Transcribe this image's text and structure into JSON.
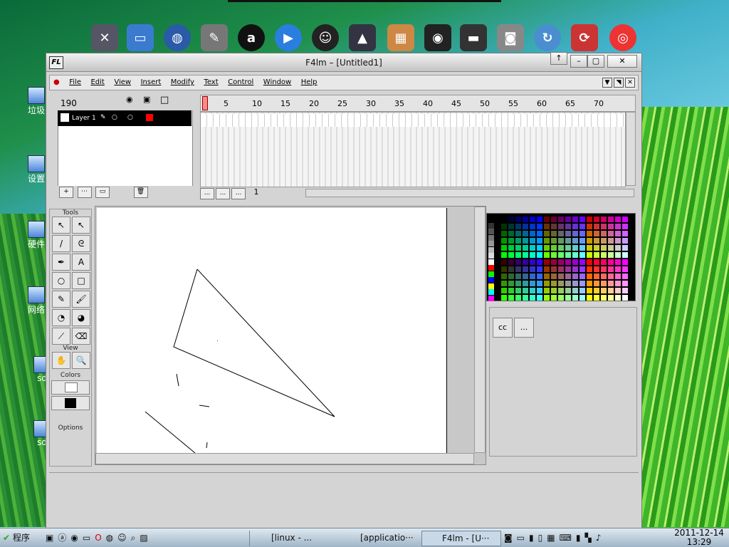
{
  "window": {
    "title": "F4lm  – [Untitled1]",
    "logo": "FL"
  },
  "menu": [
    "File",
    "Edit",
    "View",
    "Insert",
    "Modify",
    "Text",
    "Control",
    "Window",
    "Help"
  ],
  "timeline": {
    "frame_number": "190",
    "layer_name": "Layer 1",
    "ruler_ticks": [
      "5",
      "10",
      "15",
      "20",
      "25",
      "30",
      "35",
      "40",
      "45",
      "50",
      "55",
      "60",
      "65",
      "70"
    ],
    "current_frame": "1",
    "ellipsis": "..."
  },
  "tools": {
    "header": "Tools",
    "view_header": "View",
    "colors_header": "Colors",
    "options_label": "Options",
    "text_tool": "A"
  },
  "properties": {
    "cc_button": "cc",
    "more_button": "..."
  },
  "desktop_labels": [
    "垃圾",
    "设置",
    "硬件",
    "网络",
    "sd",
    "sd"
  ],
  "taskbar": {
    "start_label": "程序",
    "tasks": [
      "[linux - ...",
      "[applicatio···",
      "F4lm - [U···"
    ],
    "date": "2011-12-14",
    "time": "13:29"
  },
  "colors": {
    "stroke": "#000000",
    "fill": "#ffffff",
    "layer_color": "#ff0000"
  }
}
